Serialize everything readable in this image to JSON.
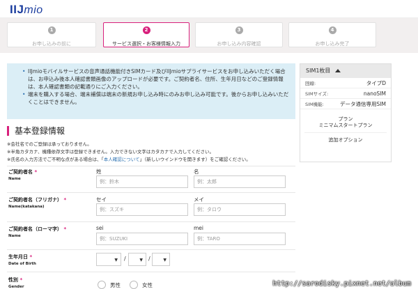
{
  "header": {
    "logo_main": "IIJ",
    "logo_sub": "mio"
  },
  "steps": [
    {
      "num": "1",
      "label": "お申し込みの前に",
      "active": false
    },
    {
      "num": "2",
      "label": "サービス選択・お客様情報入力",
      "active": true
    },
    {
      "num": "3",
      "label": "お申し込み内容確認",
      "active": false
    },
    {
      "num": "4",
      "label": "お申し込み完了",
      "active": false
    }
  ],
  "notice": {
    "items": [
      "IIJmioモバイルサービスの音声通話機能付きSIMカード及びIIJmioサプライサービスをお申し込みいただく場合は、お申込み後本人確認書類画像のアップロードが必要です。ご契約者名、住所、生年月日などのご登録情報は、本人確認書類の記載通りにご入力ください。",
      "端末を購入する場合、端末補償は端末の新規お申し込み時にのみお申し込み可能です。後からお申し込みいただくことはできません。"
    ]
  },
  "sim_panel": {
    "title": "SIM1枚目",
    "rows": [
      {
        "key": "回線:",
        "value": "タイプD"
      },
      {
        "key": "SIMサイズ:",
        "value": "nanoSIM"
      },
      {
        "key": "SIM機能:",
        "value": "データ通信専用SIM"
      }
    ],
    "plan_label": "プラン",
    "plan_value": "ミニマムスタートプラン",
    "option_label": "追加オプション"
  },
  "form": {
    "section_title": "基本登録情報",
    "notes": [
      "※会社名でのご登録は承っておりません。",
      "※半角カタカナ、機種依存文字は登録できません。入力できない文字はカタカナで入力してください。",
      "※氏名の入力方法でご不明な点がある場合は、「",
      "本人確認について",
      "」（新しいウインドウを開きます）をご確認ください。"
    ],
    "name": {
      "label_jp": "ご契約者名",
      "label_en": "Name",
      "required": "*",
      "last_label": "姓",
      "last_placeholder": "例：鈴木",
      "first_label": "名",
      "first_placeholder": "例：太郎"
    },
    "name_kana": {
      "label_jp": "ご契約者名（フリガナ）",
      "label_en": "Name(katakana)",
      "required": "*",
      "last_label": "セイ",
      "last_placeholder": "例：スズキ",
      "first_label": "メイ",
      "first_placeholder": "例：タロウ"
    },
    "name_roman": {
      "label_jp": "ご契約者名（ローマ字）",
      "label_en": "Name",
      "required": "*",
      "last_label": "sei",
      "last_placeholder": "例：SUZUKI",
      "first_label": "mei",
      "first_placeholder": "例：TARO"
    },
    "dob": {
      "label_jp": "生年月日",
      "label_en": "Date of Birth",
      "required": "*",
      "separator": "/"
    },
    "gender": {
      "label_jp": "性別",
      "label_en": "Gender",
      "required": "*",
      "male": "男性",
      "female": "女性"
    }
  },
  "watermark": "http://sarodisky.pixnet.net/album"
}
